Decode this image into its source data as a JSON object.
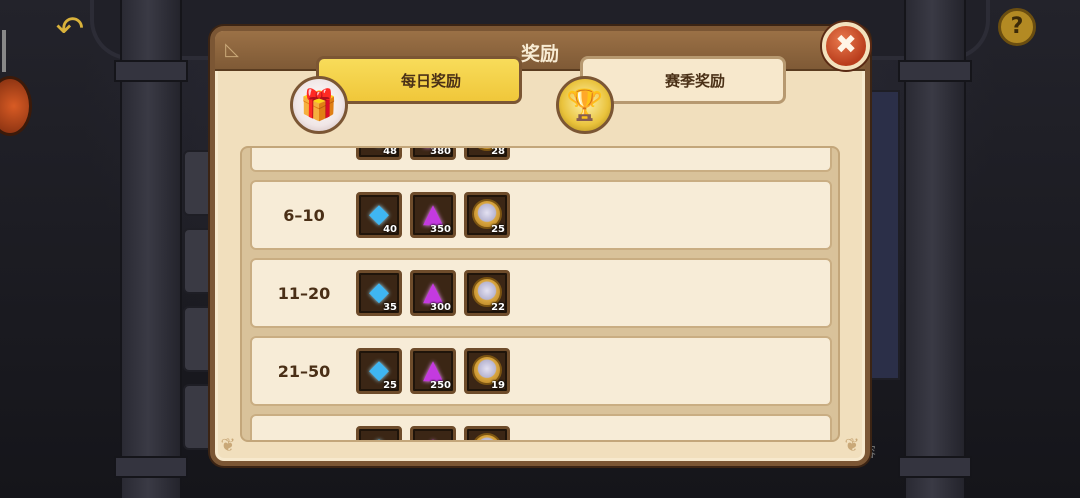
{
  "dialog": {
    "title": "奖励",
    "close_label": "✖"
  },
  "tabs": [
    {
      "label": "每日奖励",
      "active": true,
      "icon": "gift-icon"
    },
    {
      "label": "赛季奖励",
      "active": false,
      "icon": "trophy-icon"
    }
  ],
  "rewards": [
    {
      "rank": "",
      "gems": "48",
      "crystals": "380",
      "coins": "28"
    },
    {
      "rank": "6–10",
      "gems": "40",
      "crystals": "350",
      "coins": "25"
    },
    {
      "rank": "11–20",
      "gems": "35",
      "crystals": "300",
      "coins": "22"
    },
    {
      "rank": "21–50",
      "gems": "25",
      "crystals": "250",
      "coins": "19"
    },
    {
      "rank": "",
      "gems": "",
      "crystals": "",
      "coins": ""
    }
  ],
  "background": {
    "side_text": "阵容"
  },
  "colors": {
    "active_tab": "#f0c73a",
    "panel": "#f1dfbd",
    "border": "#7b5634",
    "close": "#b93d1c"
  }
}
